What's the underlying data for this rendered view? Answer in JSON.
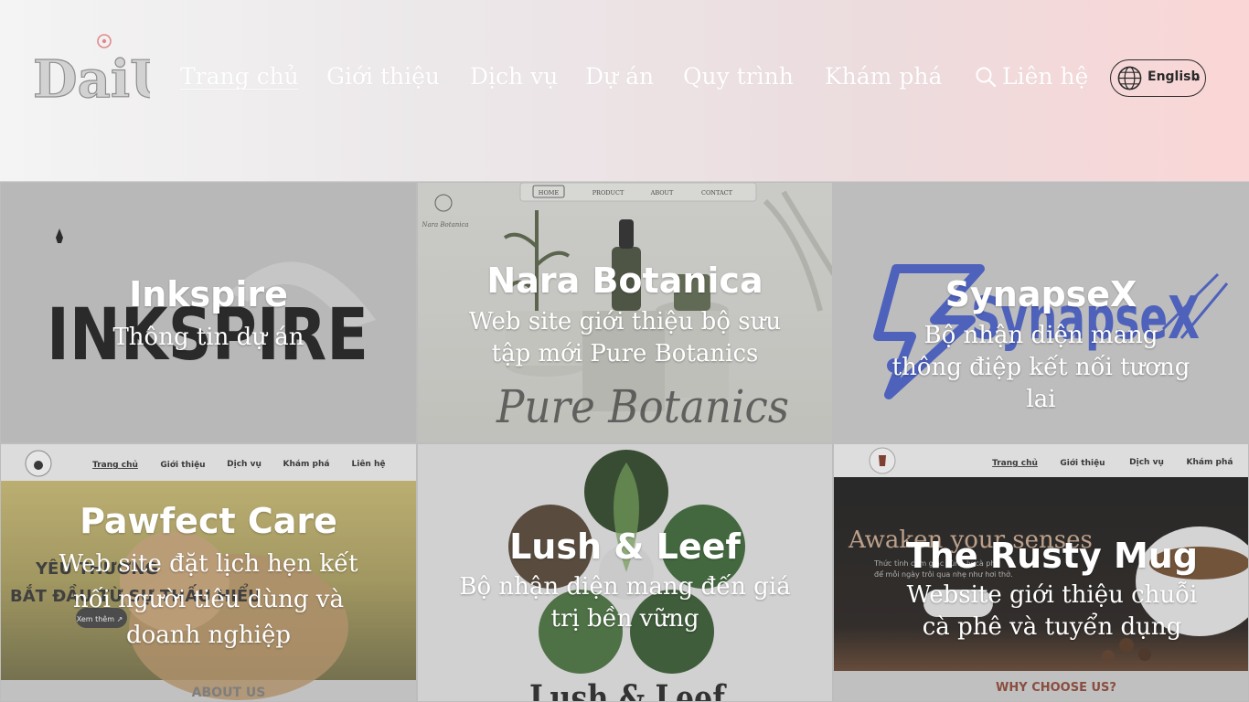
{
  "header": {
    "logo_text": "DaiU",
    "nav": [
      {
        "label": "Trang chủ",
        "active": true
      },
      {
        "label": "Giới thiệu"
      },
      {
        "label": "Dịch vụ"
      },
      {
        "label": "Dự án"
      },
      {
        "label": "Quy trình"
      },
      {
        "label": "Khám phá"
      },
      {
        "label": "Liên hệ"
      }
    ],
    "language_label": "English",
    "icons": [
      "search-icon",
      "globe-icon",
      "chevron-down-icon"
    ]
  },
  "projects": [
    {
      "title": "Inkspire",
      "description": "Thông tin dự án",
      "bg_text": "INKSPIRE"
    },
    {
      "title": "Nara Botanica",
      "description": "Web site giới thiệu bộ sưu tập mới Pure Botanics",
      "bg_text": "Pure Botanics",
      "bg_nav": [
        "HOME",
        "PRODUCT",
        "ABOUT",
        "CONTACT"
      ],
      "bg_logo": "Nara Botanica"
    },
    {
      "title": "SynapseX",
      "description": "Bộ nhận diện mang thông điệp kết nối tương lai",
      "bg_text": "SynapseX"
    },
    {
      "title": "Pawfect Care",
      "description": "Web site đặt lịch hẹn kết nối người tiêu dùng và doanh nghiệp",
      "bg_nav": [
        "Trang chủ",
        "Giới thiệu",
        "Dịch vụ",
        "Khám phá",
        "Liên hệ"
      ],
      "bg_heading_1": "YÊU THƯƠNG",
      "bg_heading_2": "BẮT ĐẦU TỪ SỰ THẤU HIỂU",
      "bg_button": "Xem thêm ↗",
      "bg_footer": "ABOUT US"
    },
    {
      "title": "Lush & Leef",
      "description": "Bộ nhận diện mang đến giá trị bền vững",
      "bg_text": "Lush & Leef"
    },
    {
      "title": "The Rusty Mug",
      "description": "Website giới thiệu chuỗi cà phê và tuyển dụng",
      "bg_nav": [
        "Trang chủ",
        "Giới thiệu",
        "Dịch vụ",
        "Khám phá"
      ],
      "bg_heading": "Awaken your senses",
      "bg_sub_1": "Thức tỉnh cảm giác cùng ly cà phê",
      "bg_sub_2": "để mỗi ngày trôi qua nhẹ như hơi thở.",
      "bg_footer": "WHY CHOOSE US?"
    }
  ],
  "colors": {
    "header_left": "#f4f4f4",
    "header_right": "#fbd6d6",
    "nav_text": "#ffffff",
    "synapse_blue": "#3d57c9",
    "rusty_footer": "#8a3b2a"
  }
}
